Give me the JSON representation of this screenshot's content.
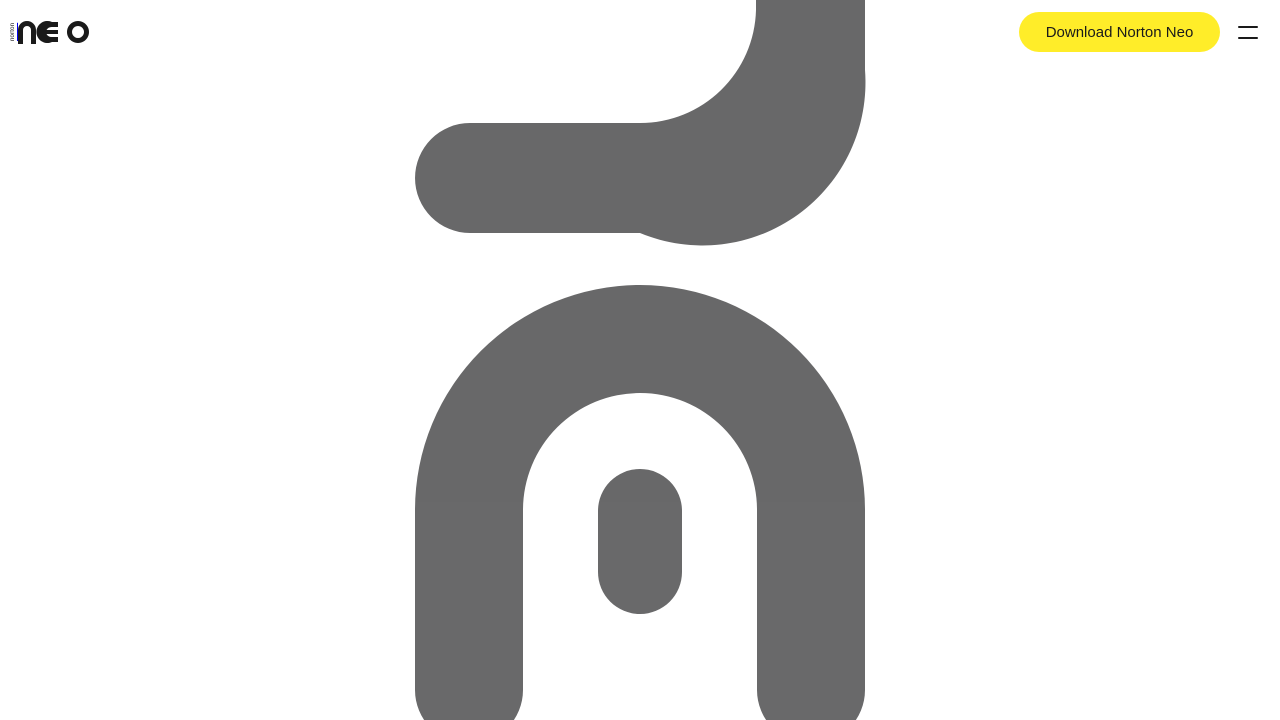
{
  "header": {
    "logo_small_text": "norton",
    "logo_main_text": "neo",
    "download_label": "Download Norton Neo"
  },
  "colors": {
    "accent": "#ffed29",
    "art_gray": "#686869",
    "text": "#1a1a1a",
    "background": "#ffffff"
  },
  "icons": {
    "menu": "hamburger-menu-icon",
    "logo": "norton-neo-logo"
  }
}
